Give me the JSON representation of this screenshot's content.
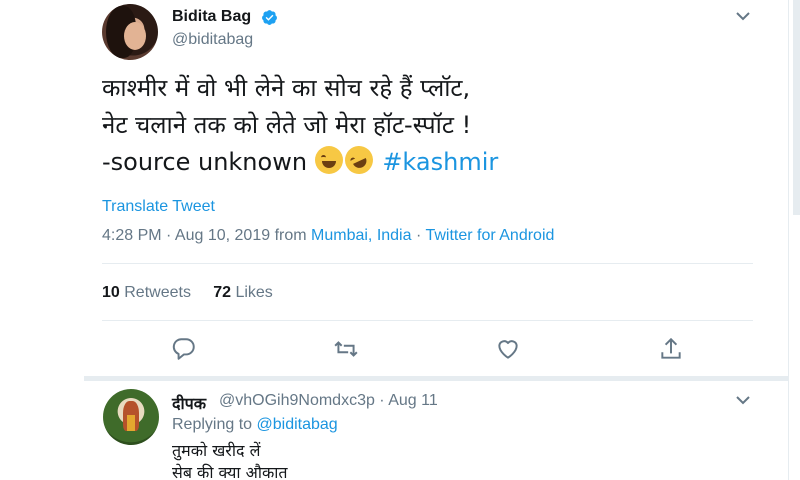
{
  "tweet": {
    "display_name": "Bidita Bag",
    "handle": "@biditabag",
    "text_line1": "काश्मीर में वो भी लेने का सोच रहे हैं प्लॉट,",
    "text_line2": "नेट चलाने तक को लेते जो मेरा हॉट-स्पॉट !",
    "text_line3_prefix": "-source unknown ",
    "hashtag": "#kashmir",
    "emojis": [
      "face-with-tears-of-joy",
      "rolling-on-the-floor-laughing"
    ],
    "translate_label": "Translate Tweet",
    "timestamp": "4:28 PM · Aug 10, 2019 from ",
    "location": "Mumbai, India",
    "dot": " · ",
    "source": "Twitter for Android",
    "retweets_count": "10",
    "retweets_label": "Retweets",
    "likes_count": "72",
    "likes_label": "Likes"
  },
  "actions": [
    "reply-icon",
    "retweet-icon",
    "like-icon",
    "share-icon"
  ],
  "reply": {
    "display_name": "दीपक",
    "handle_time": "@vhOGih9Nomdxc3p · Aug 11",
    "replying_prefix": "Replying to ",
    "replying_to": "@biditabag",
    "text_line1": "तुमको खरीद लें",
    "text_line2": "सेब की क्या औकात"
  },
  "colors": {
    "link": "#1b95e0",
    "secondary": "#657786",
    "divider": "#e6ecf0",
    "verified": "#1da1f2"
  }
}
